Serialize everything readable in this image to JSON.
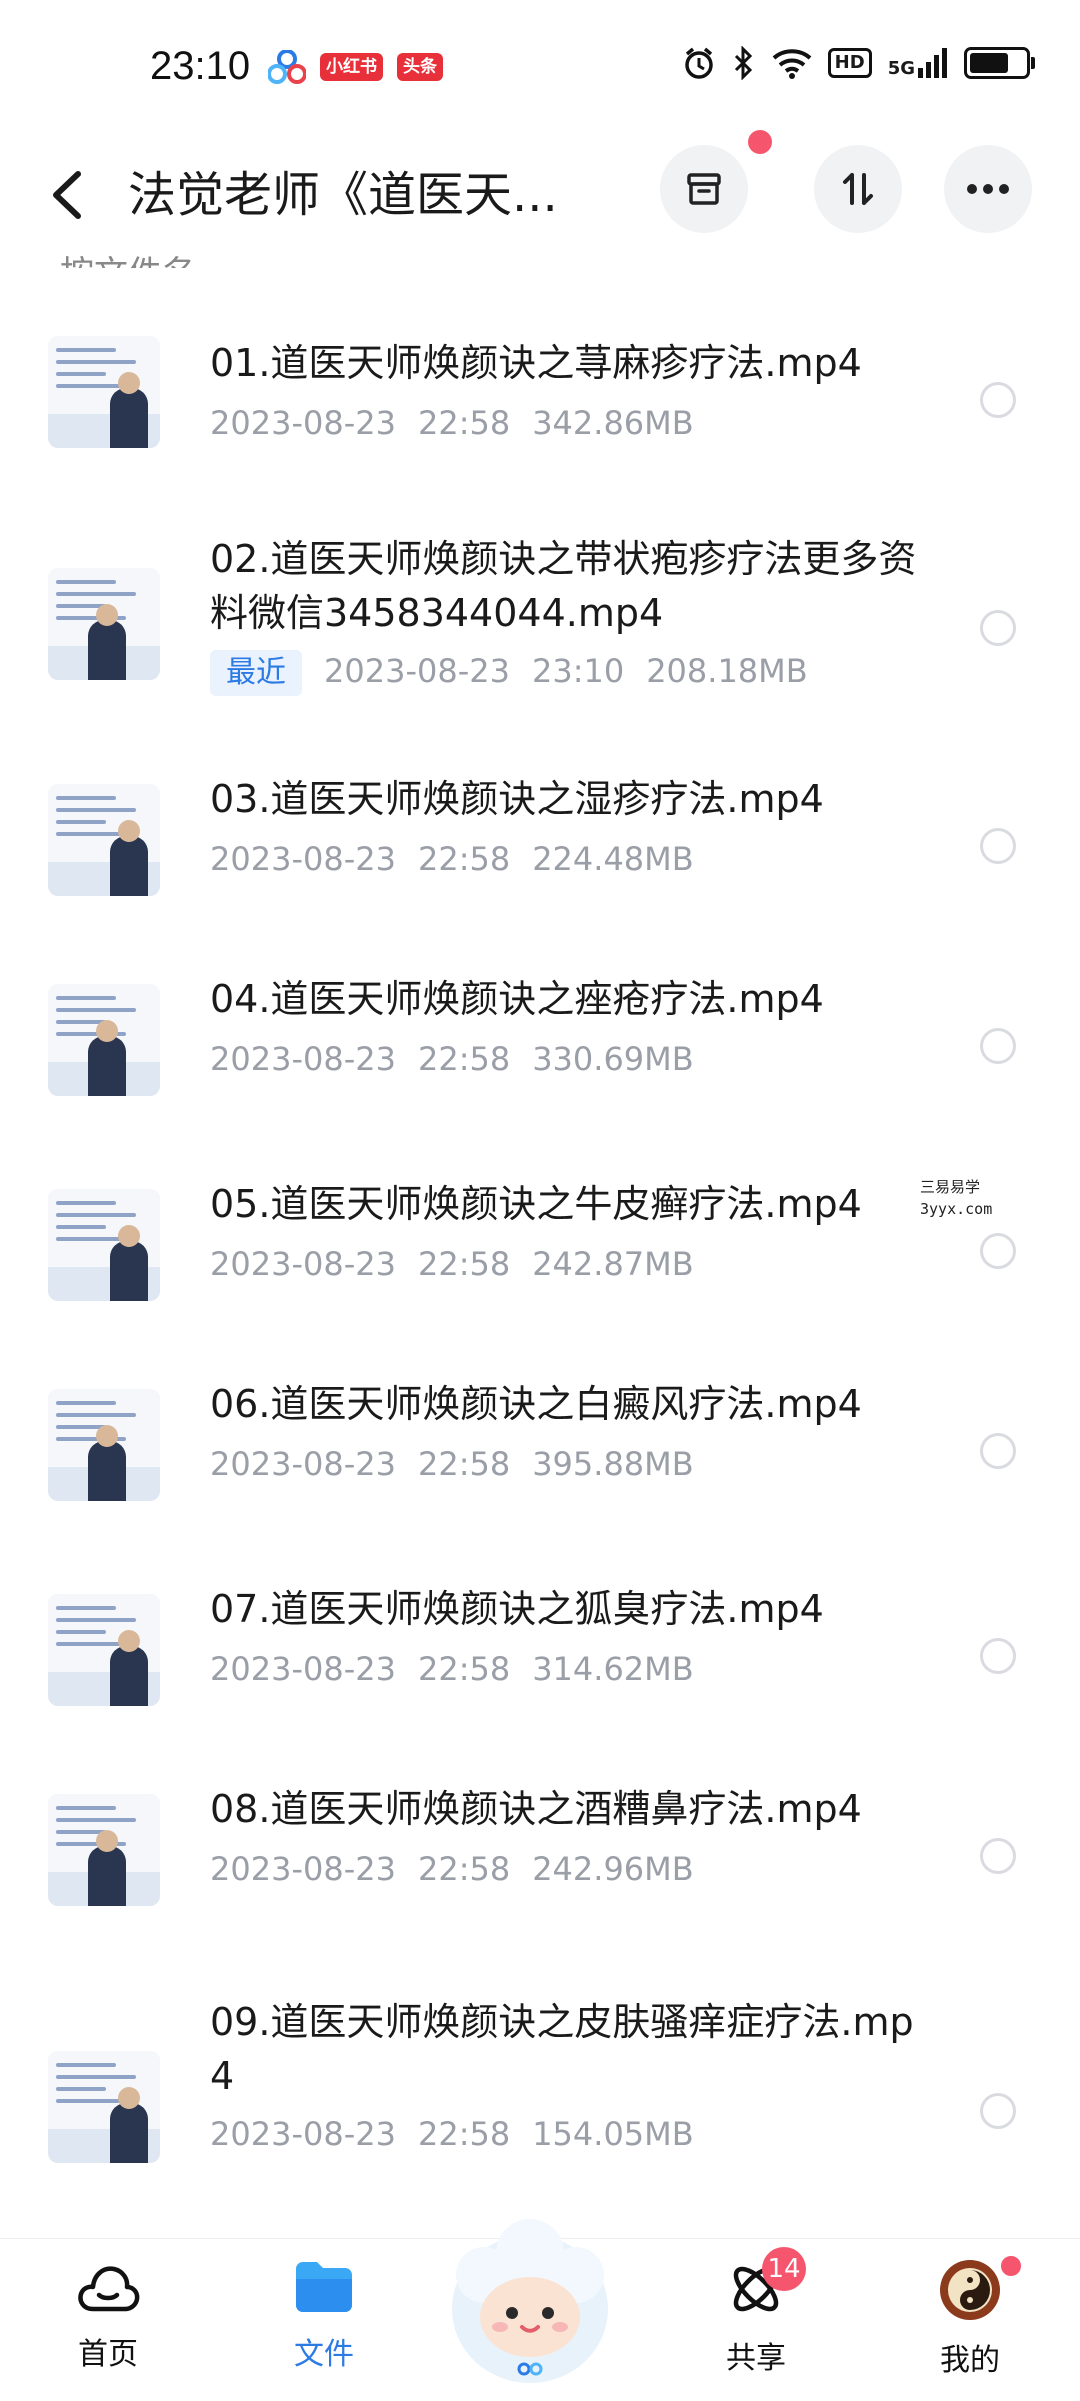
{
  "status_bar": {
    "time": "23:10",
    "app_badges": [
      "小红书",
      "头条"
    ],
    "hd_label": "HD",
    "network_label": "5G",
    "battery_level": 0.7
  },
  "header": {
    "title": "法觉老师《道医天...",
    "sort_label": "按文件名",
    "sort_dash": "---"
  },
  "files": [
    {
      "name": "01.道医天师焕颜诀之荨麻疹疗法.mp4",
      "date": "2023-08-23",
      "time": "22:58",
      "size": "342.86MB",
      "tag": ""
    },
    {
      "name": "02.道医天师焕颜诀之带状疱疹疗法更多资料微信3458344044.mp4",
      "date": "2023-08-23",
      "time": "23:10",
      "size": "208.18MB",
      "tag": "最近"
    },
    {
      "name": "03.道医天师焕颜诀之湿疹疗法.mp4",
      "date": "2023-08-23",
      "time": "22:58",
      "size": "224.48MB",
      "tag": ""
    },
    {
      "name": "04.道医天师焕颜诀之痤疮疗法.mp4",
      "date": "2023-08-23",
      "time": "22:58",
      "size": "330.69MB",
      "tag": ""
    },
    {
      "name": "05.道医天师焕颜诀之牛皮癣疗法.mp4",
      "date": "2023-08-23",
      "time": "22:58",
      "size": "242.87MB",
      "tag": ""
    },
    {
      "name": "06.道医天师焕颜诀之白癜风疗法.mp4",
      "date": "2023-08-23",
      "time": "22:58",
      "size": "395.88MB",
      "tag": ""
    },
    {
      "name": "07.道医天师焕颜诀之狐臭疗法.mp4",
      "date": "2023-08-23",
      "time": "22:58",
      "size": "314.62MB",
      "tag": ""
    },
    {
      "name": "08.道医天师焕颜诀之酒糟鼻疗法.mp4",
      "date": "2023-08-23",
      "time": "22:58",
      "size": "242.96MB",
      "tag": ""
    },
    {
      "name": "09.道医天师焕颜诀之皮肤骚痒症疗法.mp4",
      "date": "2023-08-23",
      "time": "22:58",
      "size": "154.05MB",
      "tag": ""
    }
  ],
  "watermark": {
    "line1": "三易易学",
    "line2": "3yyx.com"
  },
  "bottom_nav": {
    "home": "首页",
    "files": "文件",
    "share": "共享",
    "share_badge": "14",
    "mine": "我的"
  },
  "colors": {
    "accent": "#2c7be5",
    "badge": "#f5566d",
    "meta": "#9a9ea6"
  }
}
